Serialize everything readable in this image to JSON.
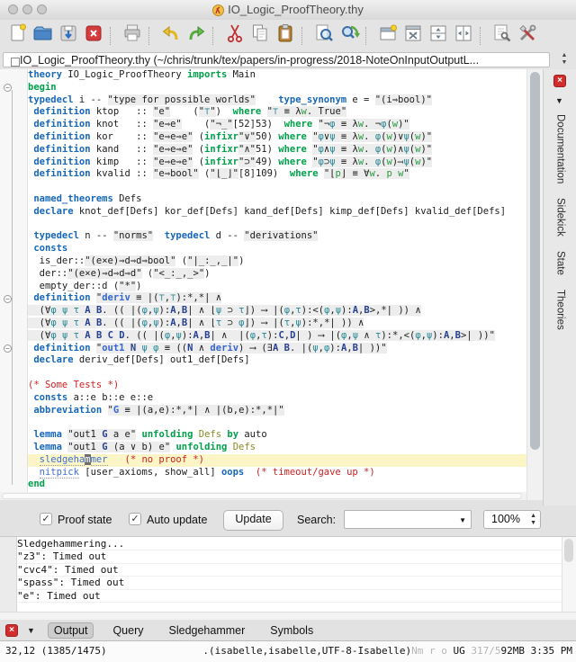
{
  "window": {
    "title": "IO_Logic_ProofTheory.thy"
  },
  "toolbar": {
    "groups": [
      [
        "new-file-icon",
        "open-file-icon",
        "save-file-icon",
        "close-buffer-icon"
      ],
      [
        "print-icon"
      ],
      [
        "undo-icon",
        "redo-icon"
      ],
      [
        "cut-icon",
        "copy-icon",
        "paste-icon"
      ],
      [
        "find-icon",
        "find-replace-icon"
      ],
      [
        "new-view-icon",
        "unsplit-icon",
        "split-horizontal-icon",
        "split-vertical-icon"
      ],
      [
        "buffer-options-icon",
        "global-options-icon"
      ]
    ]
  },
  "buffer_bar": {
    "text": "IO_Logic_ProofTheory.thy (~/chris/trunk/tex/papers/in-progress/2018-NoteOnInputOutputL..."
  },
  "editor": {
    "current_line_index": 31,
    "fold_marker_lines": [
      2,
      19,
      23
    ],
    "lines": [
      [
        [
          "c",
          "theory"
        ],
        [
          "t",
          " IO_Logic_ProofTheory "
        ],
        [
          "k",
          "imports"
        ],
        [
          "t",
          " Main"
        ]
      ],
      [
        [
          "k",
          "begin"
        ]
      ],
      [
        [
          "c",
          "typedecl"
        ],
        [
          "t",
          " i -- "
        ],
        [
          "q",
          "\"type for possible worlds\""
        ],
        [
          "t",
          "    "
        ],
        [
          "c",
          "type_synonym"
        ],
        [
          "t",
          " e = "
        ],
        [
          "q",
          "\"(i⇒bool)\""
        ]
      ],
      [
        [
          "t",
          " "
        ],
        [
          "c",
          "definition"
        ],
        [
          "t",
          " ktop   :: "
        ],
        [
          "q",
          "\"e\""
        ],
        [
          "t",
          "    ("
        ],
        [
          "q",
          "\"⊤\""
        ],
        [
          "t",
          ")  "
        ],
        [
          "k",
          "where"
        ],
        [
          "t",
          " "
        ],
        [
          "q",
          "\"⊤ ≡ λw. True\""
        ]
      ],
      [
        [
          "t",
          " "
        ],
        [
          "c",
          "definition"
        ],
        [
          "t",
          " knot   :: "
        ],
        [
          "q",
          "\"e⇒e\""
        ],
        [
          "t",
          "    ("
        ],
        [
          "q",
          "\"¬_\""
        ],
        [
          "t",
          "[52]53)  "
        ],
        [
          "k",
          "where"
        ],
        [
          "t",
          " "
        ],
        [
          "q",
          "\"¬φ ≡ λw. ¬φ(w)\""
        ]
      ],
      [
        [
          "t",
          " "
        ],
        [
          "c",
          "definition"
        ],
        [
          "t",
          " kor    :: "
        ],
        [
          "q",
          "\"e⇒e⇒e\""
        ],
        [
          "t",
          " ("
        ],
        [
          "k",
          "infixr"
        ],
        [
          "q",
          "\"∨\""
        ],
        [
          "t",
          "50) "
        ],
        [
          "k",
          "where"
        ],
        [
          "t",
          " "
        ],
        [
          "q",
          "\"φ∨ψ ≡ λw. φ(w)∨ψ(w)\""
        ]
      ],
      [
        [
          "t",
          " "
        ],
        [
          "c",
          "definition"
        ],
        [
          "t",
          " kand   :: "
        ],
        [
          "q",
          "\"e⇒e⇒e\""
        ],
        [
          "t",
          " ("
        ],
        [
          "k",
          "infixr"
        ],
        [
          "q",
          "\"∧\""
        ],
        [
          "t",
          "51) "
        ],
        [
          "k",
          "where"
        ],
        [
          "t",
          " "
        ],
        [
          "q",
          "\"φ∧ψ ≡ λw. φ(w)∧ψ(w)\""
        ]
      ],
      [
        [
          "t",
          " "
        ],
        [
          "c",
          "definition"
        ],
        [
          "t",
          " kimp   :: "
        ],
        [
          "q",
          "\"e⇒e⇒e\""
        ],
        [
          "t",
          " ("
        ],
        [
          "k",
          "infixr"
        ],
        [
          "q",
          "\"⊃\""
        ],
        [
          "t",
          "49) "
        ],
        [
          "k",
          "where"
        ],
        [
          "t",
          " "
        ],
        [
          "q",
          "\"φ⊃ψ ≡ λw. φ(w)⟶ψ(w)\""
        ]
      ],
      [
        [
          "t",
          " "
        ],
        [
          "c",
          "definition"
        ],
        [
          "t",
          " kvalid :: "
        ],
        [
          "q",
          "\"e⇒bool\""
        ],
        [
          "t",
          " ("
        ],
        [
          "q",
          "\"⌊_⌋\""
        ],
        [
          "t",
          "[8]109)  "
        ],
        [
          "k",
          "where"
        ],
        [
          "t",
          " "
        ],
        [
          "q",
          "\"⌊p⌋ ≡ ∀w. p w\""
        ]
      ],
      [],
      [
        [
          "t",
          " "
        ],
        [
          "c",
          "named_theorems"
        ],
        [
          "t",
          " Defs"
        ]
      ],
      [
        [
          "t",
          " "
        ],
        [
          "c",
          "declare"
        ],
        [
          "t",
          " knot_def[Defs] kor_def[Defs] kand_def[Defs] kimp_def[Defs] kvalid_def[Defs]"
        ]
      ],
      [],
      [
        [
          "t",
          " "
        ],
        [
          "c",
          "typedecl"
        ],
        [
          "t",
          " n -- "
        ],
        [
          "q",
          "\"norms\""
        ],
        [
          "t",
          "  "
        ],
        [
          "c",
          "typedecl"
        ],
        [
          "t",
          " d -- "
        ],
        [
          "q",
          "\"derivations\""
        ]
      ],
      [
        [
          "t",
          " "
        ],
        [
          "c",
          "consts"
        ]
      ],
      [
        [
          "t",
          "  is_der::"
        ],
        [
          "q",
          "\"(e×e)⇒d⇒d⇒bool\""
        ],
        [
          "t",
          " ("
        ],
        [
          "q",
          "\"|_:_,_|\""
        ],
        [
          "t",
          ")"
        ]
      ],
      [
        [
          "t",
          "  der::"
        ],
        [
          "q",
          "\"(e×e)⇒d⇒d⇒d\""
        ],
        [
          "t",
          " ("
        ],
        [
          "q",
          "\"<_:_,_>\""
        ],
        [
          "t",
          ")"
        ]
      ],
      [
        [
          "t",
          "  empty_der::d ("
        ],
        [
          "q",
          "\"*\""
        ],
        [
          "t",
          ")"
        ]
      ],
      [
        [
          "t",
          " "
        ],
        [
          "c",
          "definition"
        ],
        [
          "t",
          " "
        ],
        [
          "q",
          "\""
        ],
        [
          "qb",
          "deriv"
        ],
        [
          "q",
          " ≡ |(⊤,⊤):*,*| ∧"
        ]
      ],
      [
        [
          "q",
          "  (∀φ ψ τ A B. (( |(φ,ψ):A,B| ∧ ⌊ψ ⊃ τ⌋) ⟶ |(φ,τ):<(φ,ψ):A,B>,*| )) ∧"
        ]
      ],
      [
        [
          "q",
          "  (∀φ ψ τ A B. (( |(φ,ψ):A,B| ∧ ⌊τ ⊃ φ⌋) ⟶ |(τ,ψ):*,*| )) ∧"
        ]
      ],
      [
        [
          "q",
          "  (∀φ ψ τ A B C D. (( |(φ,ψ):A,B| ∧  |(φ,τ):C,D| ) ⟶ |(φ,ψ ∧ τ):*,<(φ,ψ):A,B>| ))\""
        ]
      ],
      [
        [
          "t",
          " "
        ],
        [
          "c",
          "definition"
        ],
        [
          "t",
          " "
        ],
        [
          "q",
          "\""
        ],
        [
          "qb",
          "out1"
        ],
        [
          "q",
          " N ψ φ ≡ ((N ∧ "
        ],
        [
          "qb",
          "deriv"
        ],
        [
          "q",
          ") ⟶ (∃A B. |(ψ,φ):A,B| ))\""
        ]
      ],
      [
        [
          "t",
          " "
        ],
        [
          "c",
          "declare"
        ],
        [
          "t",
          " deriv_def[Defs] out1_def[Defs]"
        ]
      ],
      [],
      [
        [
          "cm",
          "(* Some Tests *)"
        ]
      ],
      [
        [
          "t",
          " "
        ],
        [
          "c",
          "consts"
        ],
        [
          "t",
          " a::e b::e e::e"
        ]
      ],
      [
        [
          "t",
          " "
        ],
        [
          "c",
          "abbreviation"
        ],
        [
          "t",
          " "
        ],
        [
          "q",
          "\""
        ],
        [
          "qb",
          "G"
        ],
        [
          "q",
          " ≡ |(a,e):*,*| ∧ |(b,e):*,*|\""
        ]
      ],
      [],
      [
        [
          "t",
          " "
        ],
        [
          "c",
          "lemma"
        ],
        [
          "t",
          " "
        ],
        [
          "q",
          "\"out1 G a e\""
        ],
        [
          "t",
          " "
        ],
        [
          "k",
          "unfolding"
        ],
        [
          "t",
          " "
        ],
        [
          "d",
          "Defs"
        ],
        [
          "t",
          " "
        ],
        [
          "k",
          "by"
        ],
        [
          "t",
          " auto"
        ]
      ],
      [
        [
          "t",
          " "
        ],
        [
          "c",
          "lemma"
        ],
        [
          "t",
          " "
        ],
        [
          "q",
          "\"out1 G (a ∨ b) e\""
        ],
        [
          "t",
          " "
        ],
        [
          "k",
          "unfolding"
        ],
        [
          "t",
          " "
        ],
        [
          "d",
          "Defs"
        ]
      ],
      [
        [
          "t",
          "  "
        ],
        [
          "u",
          "sledgeha"
        ],
        [
          "cur",
          "m"
        ],
        [
          "u",
          "mer"
        ],
        [
          "t",
          "   "
        ],
        [
          "cm",
          "(* no proof *)"
        ]
      ],
      [
        [
          "t",
          "  "
        ],
        [
          "u",
          "nitpick"
        ],
        [
          "t",
          " [user_axioms, show_all] "
        ],
        [
          "c",
          "oops"
        ],
        [
          "t",
          "  "
        ],
        [
          "cm",
          "(* timeout/gave up *)"
        ]
      ],
      [
        [
          "k",
          "end"
        ]
      ]
    ]
  },
  "right_dock": {
    "items": [
      "Documentation",
      "Sidekick",
      "State",
      "Theories"
    ]
  },
  "controls": {
    "proof_state_label": "Proof state",
    "proof_state_checked": "✓",
    "auto_update_label": "Auto update",
    "auto_update_checked": "✓",
    "update_button": "Update",
    "search_label": "Search:",
    "search_value": "",
    "zoom_value": "100%"
  },
  "output_panel": {
    "lines": [
      "Sledgehammering...",
      "\"z3\": Timed out",
      "\"cvc4\": Timed out",
      "\"spass\": Timed out",
      "\"e\": Timed out"
    ]
  },
  "bottom_tabs": {
    "tabs": [
      "Output",
      "Query",
      "Sledgehammer",
      "Symbols"
    ],
    "active": "Output"
  },
  "status_bar": {
    "caret": "32,12 (1385/1475)",
    "mode": ".(isabelle,isabelle,UTF-8-Isabelle)",
    "flags_dim": "Nm r o ",
    "flags": "UG",
    "memory_dim": " 317/5",
    "memory": "92MB",
    "time": " 3:35 PM"
  }
}
